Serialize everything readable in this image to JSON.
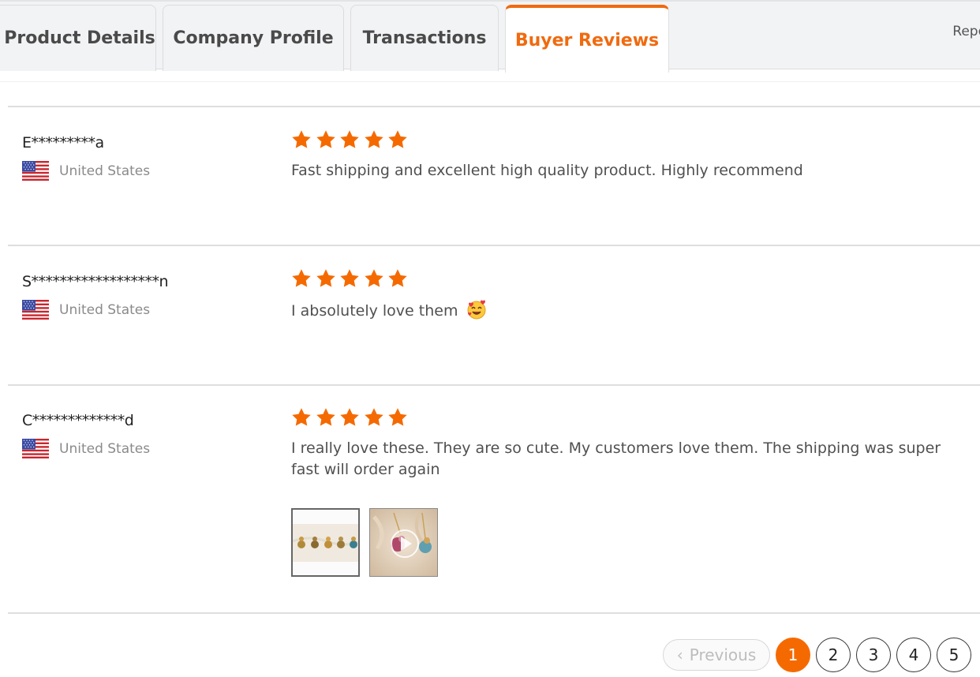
{
  "tabs": [
    {
      "label": "Product Details",
      "active": false
    },
    {
      "label": "Company Profile",
      "active": false
    },
    {
      "label": "Transactions",
      "active": false
    },
    {
      "label": "Buyer Reviews",
      "active": true
    }
  ],
  "report_link": "Repo",
  "accent_color": "#f06a0f",
  "star_color": "#f56a00",
  "reviews": [
    {
      "reviewer": "E*********a",
      "country": "United States",
      "flag": "us-flag-icon",
      "rating": 5,
      "comment": "Fast shipping and excellent high quality product. Highly recommend"
    },
    {
      "reviewer": "S******************n",
      "country": "United States",
      "flag": "us-flag-icon",
      "rating": 5,
      "comment": "I absolutely love them",
      "emoji": "smiling-face-with-hearts-icon"
    },
    {
      "reviewer": "C*************d",
      "country": "United States",
      "flag": "us-flag-icon",
      "rating": 5,
      "comment": "I really love these. They are so cute. My customers love them. The shipping was super fast will order again",
      "attachments": [
        "photo-thumbnail",
        "video-thumbnail"
      ]
    }
  ],
  "pagination": {
    "previous_label": "Previous",
    "pages": [
      "1",
      "2",
      "3",
      "4",
      "5"
    ],
    "current": "1"
  }
}
